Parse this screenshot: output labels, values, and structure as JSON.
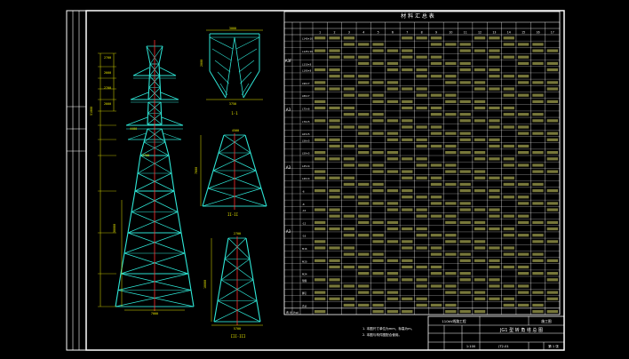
{
  "drawing": {
    "table_title": "材 料 汇 总 表",
    "title_block": {
      "project": "110kV线路工程",
      "stage": "施工图",
      "drawing_title": "JG1 型 转 角 塔 总 图",
      "scale": "1:100",
      "drawing_no": "JT2-01",
      "sheet": "第 1 张"
    },
    "notes": [
      "1. 本图尺寸单位为mm，标高为m。",
      "2. 本图与构件图配合使用。"
    ],
    "section_labels": [
      "1-1",
      "II-II",
      "III-III"
    ],
    "tower_dims": {
      "top_left": [
        "2700",
        "2000",
        "2700",
        "2000"
      ],
      "overall_height": "51000",
      "lower_height": "30000",
      "arm_width": "4400",
      "arm_width2": "2700",
      "base_width": "7000"
    },
    "section_dims": {
      "s1": [
        "3000",
        "2000",
        "3750"
      ],
      "s2": [
        "4500",
        "7000"
      ],
      "s3": [
        "2700",
        "10000",
        "5700"
      ]
    },
    "table": {
      "group_labels": [
        "A3F",
        "A3",
        "A3",
        "A3"
      ],
      "header": [
        "1",
        "2",
        "3",
        "4",
        "5",
        "6",
        "7",
        "8",
        "9",
        "10",
        "11",
        "12",
        "13",
        "14",
        "15",
        "16",
        "17"
      ],
      "row_labels": [
        "L140×10",
        "L125×10",
        "L110×8",
        "L100×8",
        "L90×7",
        "L80×7",
        "L75×6",
        "L70×5",
        "L63×5",
        "L56×5",
        "L50×5",
        "L45×4",
        "L40×4",
        "-6",
        "-8",
        "-10",
        "-12",
        "-16",
        "M16",
        "M20",
        "M24",
        "垫圈",
        "脚钉",
        "合计"
      ],
      "total_label": "合 计 (kg)"
    }
  }
}
